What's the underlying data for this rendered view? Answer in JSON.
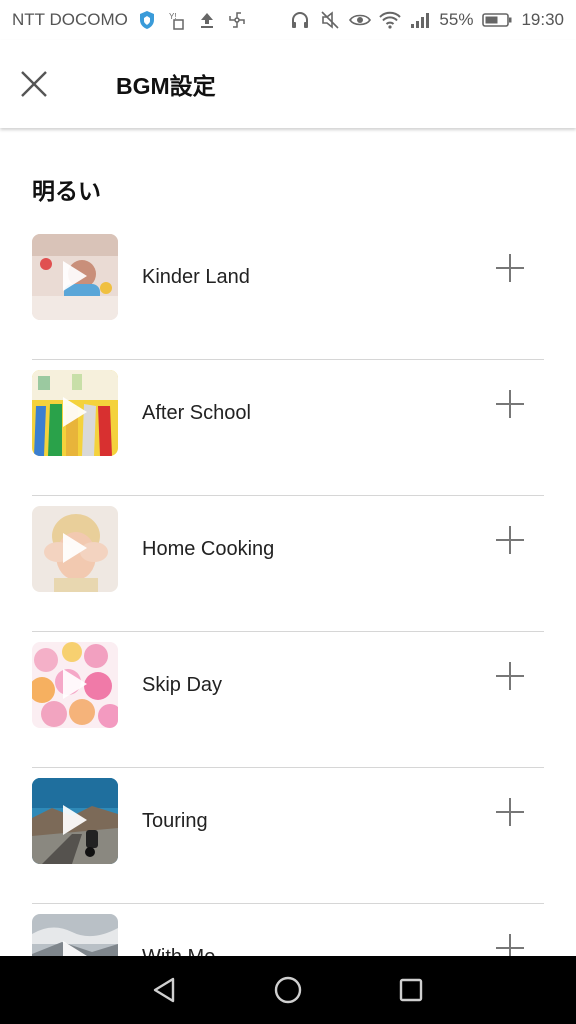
{
  "status_bar": {
    "carrier": "NTT DOCOMO",
    "battery": "55%",
    "time": "19:30",
    "icons": [
      "shield-icon",
      "sim-icon",
      "upload-icon",
      "pinwheel-icon",
      "headphones-icon",
      "mute-icon",
      "eye-icon",
      "wifi-icon",
      "signal-icon",
      "battery-icon"
    ]
  },
  "header": {
    "close_icon": "close-icon",
    "title": "BGM設定"
  },
  "section": {
    "title": "明るい"
  },
  "tracks": [
    {
      "name": "Kinder Land",
      "thumb_color": "#cfa9a0",
      "add_icon": "plus-icon"
    },
    {
      "name": "After School",
      "thumb_color": "#f4d23c",
      "add_icon": "plus-icon"
    },
    {
      "name": "Home Cooking",
      "thumb_color": "#e8d9c8",
      "add_icon": "plus-icon"
    },
    {
      "name": "Skip Day",
      "thumb_color": "#f2a8c4",
      "add_icon": "plus-icon"
    },
    {
      "name": "Touring",
      "thumb_color": "#3f8fb5",
      "add_icon": "plus-icon"
    },
    {
      "name": "With Me",
      "thumb_color": "#9aa2a8",
      "add_icon": "plus-icon"
    }
  ],
  "nav": {
    "icons": [
      "back-triangle-icon",
      "home-circle-icon",
      "recents-square-icon"
    ]
  },
  "colors": {
    "background": "#ffffff",
    "divider": "#d6d6d6",
    "nav_bar": "#000000",
    "text": "#222222"
  }
}
